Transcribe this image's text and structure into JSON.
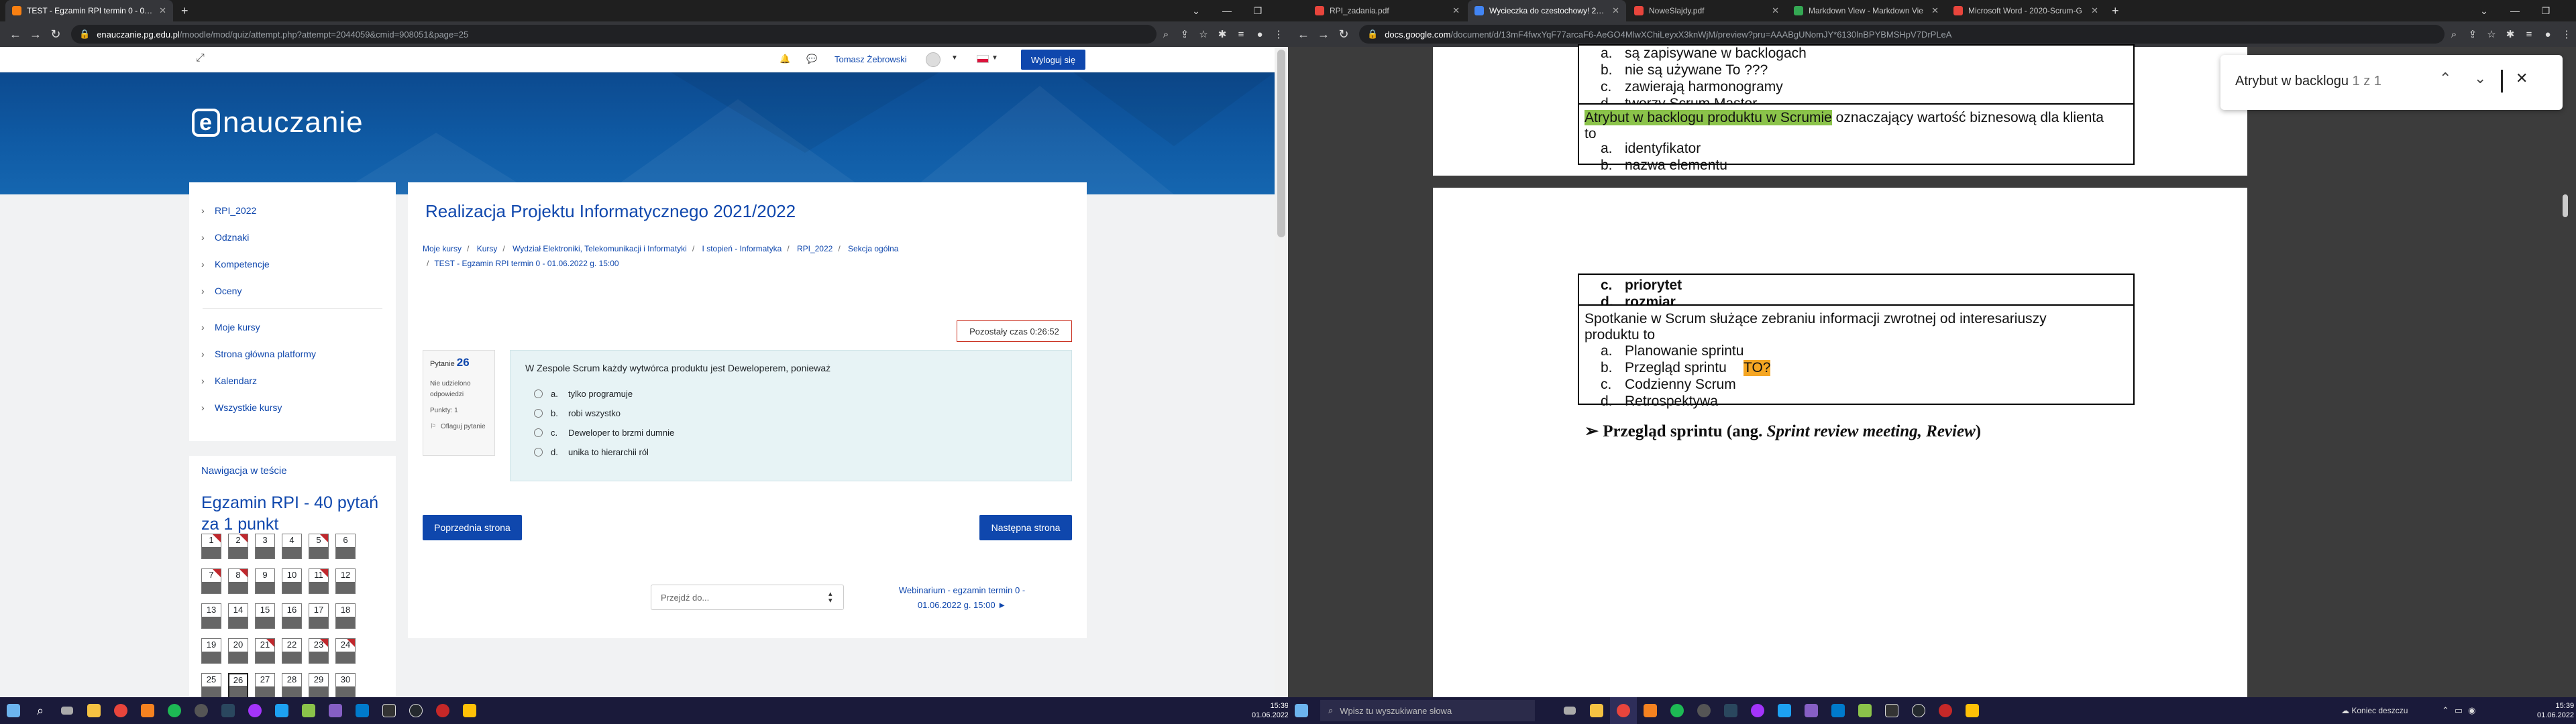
{
  "left_browser": {
    "tabs": [
      {
        "title": "TEST - Egzamin RPI termin 0 - 01.06",
        "active": true,
        "color": "#f98012"
      }
    ],
    "url_host": "enauczanie.pg.edu.pl",
    "url_path": "/moodle/mod/quiz/attempt.php?attempt=2044059&cmid=908051&page=25"
  },
  "moodle": {
    "user_name": "Tomasz Żebrowski",
    "logout_label": "Wyloguj się",
    "logo_letter": "e",
    "logo_text": "nauczanie",
    "sidebar_items": [
      "RPI_2022",
      "Odznaki",
      "Kompetencje",
      "Oceny",
      "Moje kursy",
      "Strona główna platformy",
      "Kalendarz",
      "Wszystkie kursy"
    ],
    "nav_heading": "Nawigacja w teście",
    "quiz_title": "Egzamin RPI - 40 pytań za 1 punkt",
    "question_numbers": [
      "1",
      "2",
      "3",
      "4",
      "5",
      "6",
      "7",
      "8",
      "9",
      "10",
      "11",
      "12",
      "13",
      "14",
      "15",
      "16",
      "17",
      "18",
      "19",
      "20",
      "21",
      "22",
      "23",
      "24",
      "25",
      "26",
      "27",
      "28",
      "29",
      "30"
    ],
    "course_title": "Realizacja Projektu Informatycznego 2021/2022",
    "breadcrumb": [
      "Moje kursy",
      "Kursy",
      "Wydział Elektroniki, Telekomunikacji i Informatyki",
      "I stopień - Informatyka",
      "RPI_2022",
      "Sekcja ogólna",
      "TEST - Egzamin RPI termin 0 - 01.06.2022 g. 15:00"
    ],
    "timer_label": "Pozostały czas 0:26:52",
    "question": {
      "label": "Pytanie",
      "number": "26",
      "status": "Nie udzielono odpowiedzi",
      "points": "Punkty: 1",
      "flag_label": "Oflaguj pytanie",
      "text": "W Zespole Scrum każdy wytwórca produktu jest Deweloperem, ponieważ",
      "options": [
        {
          "letter": "a.",
          "text": "tylko programuje"
        },
        {
          "letter": "b.",
          "text": "robi wszystko"
        },
        {
          "letter": "c.",
          "text": "Deweloper to brzmi dumnie"
        },
        {
          "letter": "d.",
          "text": "unika to hierarchii ról"
        }
      ]
    },
    "prev_button": "Poprzednia strona",
    "next_button": "Następna strona",
    "jump_placeholder": "Przejdź do...",
    "next_activity": "Webinarium - egzamin termin 0 - 01.06.2022 g. 15:00 ►"
  },
  "right_browser": {
    "tabs": [
      {
        "title": "RPI_zadania.pdf",
        "active": false,
        "color": "#e8453c"
      },
      {
        "title": "Wycieczka do czestochowy! 2022",
        "active": true,
        "color": "#4285f4"
      },
      {
        "title": "NoweSlajdy.pdf",
        "active": false,
        "color": "#e8453c"
      },
      {
        "title": "Markdown View - Markdown Vie",
        "active": false,
        "color": "#34a853"
      },
      {
        "title": "Microsoft Word - 2020-Scrum-G",
        "active": false,
        "color": "#e8453c"
      }
    ],
    "url_host": "docs.google.com",
    "url_path": "/document/d/13mF4fwxYqF77arcaF6-AeGO4MlwXChiLeyxX3knWjM/preview?pru=AAABgUNomJY*6130lnBPYBMSHpV7DrPLeA"
  },
  "doc": {
    "block1": [
      {
        "letter": "a.",
        "text": "są zapisywane w backlogach"
      },
      {
        "letter": "b.",
        "text": "nie są używane    To ???"
      },
      {
        "letter": "c.",
        "text": "zawierają harmonogramy"
      },
      {
        "letter": "d.",
        "text": "tworzy Scrum Master"
      }
    ],
    "q2_highlight": "Atrybut w backlogu produktu w Scrumie",
    "q2_rest": " oznaczający wartość biznesową dla klienta",
    "q2_line2": "to",
    "q2_options": [
      {
        "letter": "a.",
        "text": "identyfikator"
      },
      {
        "letter": "b.",
        "text": "nazwa elementu"
      }
    ],
    "page2_options": [
      {
        "letter": "c.",
        "text": "priorytet"
      },
      {
        "letter": "d.",
        "text": "rozmiar"
      }
    ],
    "q3_line1": "Spotkanie w Scrum służące zebraniu informacji zwrotnej od interesariuszy",
    "q3_line2": "produktu to",
    "q3_options": [
      {
        "letter": "a.",
        "text": "Planowanie sprintu"
      },
      {
        "letter": "b.",
        "text": "Przegląd sprintu"
      },
      {
        "letter": "c.",
        "text": "Codzienny Scrum"
      },
      {
        "letter": "d.",
        "text": "Retrospektywa"
      }
    ],
    "q3_mark": "TO?",
    "heading_prefix": "Przegląd sprintu (ang. ",
    "heading_italic": "Sprint review meeting, Review",
    "heading_suffix": ")"
  },
  "find": {
    "query": "Atrybut w backlogu",
    "count": "1 z 1"
  },
  "taskbar": {
    "left_time": "15:39",
    "left_date": "01.06.2022",
    "right_time": "15:39",
    "right_date": "01.06.2022",
    "search_placeholder": "Wpisz tu wyszukiwane słowa",
    "notify": "Koniec deszczu"
  },
  "colors": {
    "moodle_blue": "#0f47ad",
    "highlight_green": "#8bc34a",
    "highlight_orange": "#f5a623"
  }
}
